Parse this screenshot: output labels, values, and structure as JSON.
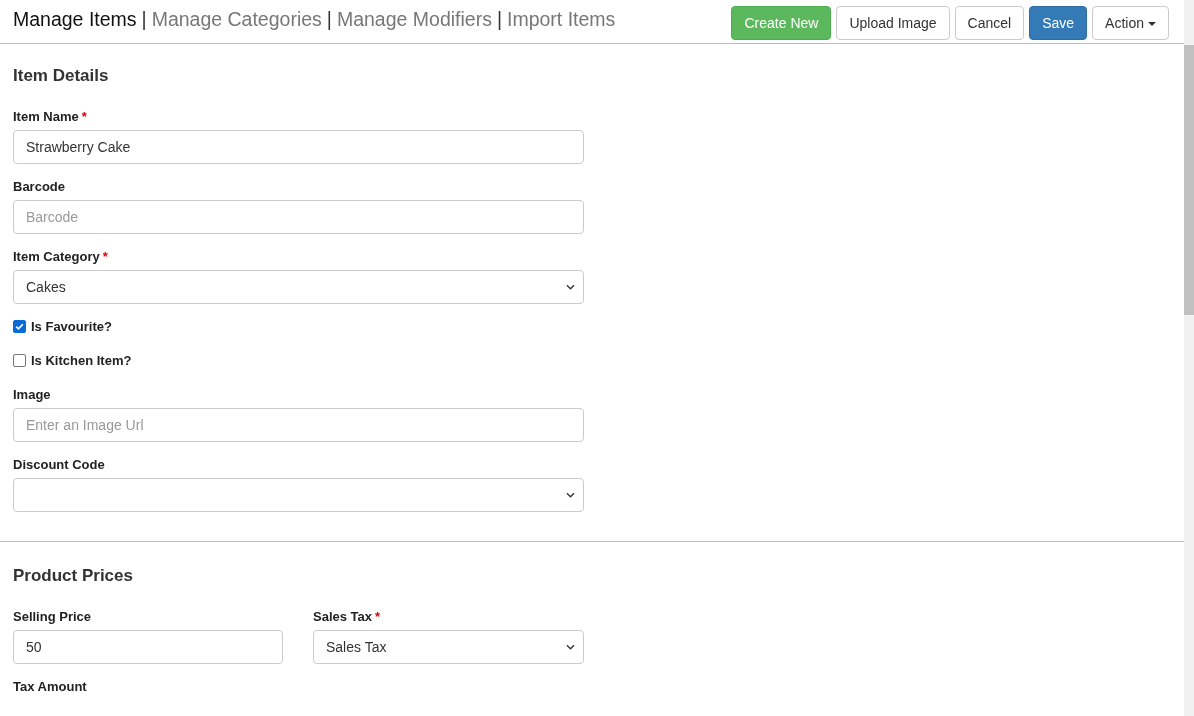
{
  "nav": {
    "tabs": [
      {
        "label": "Manage Items",
        "selected": true
      },
      {
        "label": "Manage Categories",
        "selected": false
      },
      {
        "label": "Manage Modifiers",
        "selected": false
      },
      {
        "label": "Import Items",
        "selected": false
      }
    ],
    "separator": "|"
  },
  "actions": [
    {
      "label": "Create New",
      "kind": "create"
    },
    {
      "label": "Upload Image",
      "kind": "upload"
    },
    {
      "label": "Cancel",
      "kind": "cancel"
    },
    {
      "label": "Save",
      "kind": "save"
    },
    {
      "label": "Action",
      "kind": "menu"
    }
  ],
  "item_details": {
    "title": "Item Details",
    "fields": [
      {
        "kind": "text",
        "label": "Item Name",
        "required_mark": "*",
        "value": "Strawberry Cake"
      },
      {
        "kind": "text",
        "label": "Barcode",
        "placeholder": "Barcode"
      },
      {
        "kind": "select",
        "label": "Item Category",
        "required_mark": "*",
        "value": "Cakes"
      },
      {
        "kind": "checkbox",
        "label": "Is Favourite?",
        "checked": true
      },
      {
        "kind": "checkbox",
        "label": "Is Kitchen Item?",
        "checked": false
      },
      {
        "kind": "text",
        "label": "Image",
        "placeholder": "Enter an Image Url"
      },
      {
        "kind": "select",
        "label": "Discount Code"
      }
    ]
  },
  "product_prices": {
    "title": "Product Prices",
    "fields": [
      {
        "kind": "text",
        "label": "Selling Price",
        "value": "50"
      },
      {
        "kind": "select",
        "label": "Sales Tax",
        "required_mark": "*",
        "value": "Sales Tax"
      },
      {
        "kind": "label",
        "label": "Tax Amount"
      }
    ]
  }
}
